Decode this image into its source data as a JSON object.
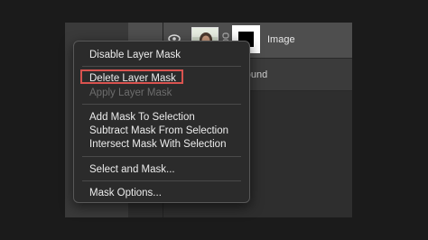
{
  "layers_panel": {
    "layer_1_name": "Image",
    "layer_2_name_partial": "ground"
  },
  "context_menu": {
    "items": [
      {
        "label": "Disable Layer Mask",
        "enabled": true
      },
      {
        "label": "Delete Layer Mask",
        "enabled": true,
        "highlighted": true
      },
      {
        "label": "Apply Layer Mask",
        "enabled": false
      },
      {
        "label": "Add Mask To Selection",
        "enabled": true
      },
      {
        "label": "Subtract Mask From Selection",
        "enabled": true
      },
      {
        "label": "Intersect Mask With Selection",
        "enabled": true
      },
      {
        "label": "Select and Mask...",
        "enabled": true
      },
      {
        "label": "Mask Options...",
        "enabled": true
      }
    ]
  },
  "colors": {
    "highlight_outline": "#d9534f",
    "menu_background": "#2b2b2b",
    "disabled_text": "#6d6d6d"
  }
}
